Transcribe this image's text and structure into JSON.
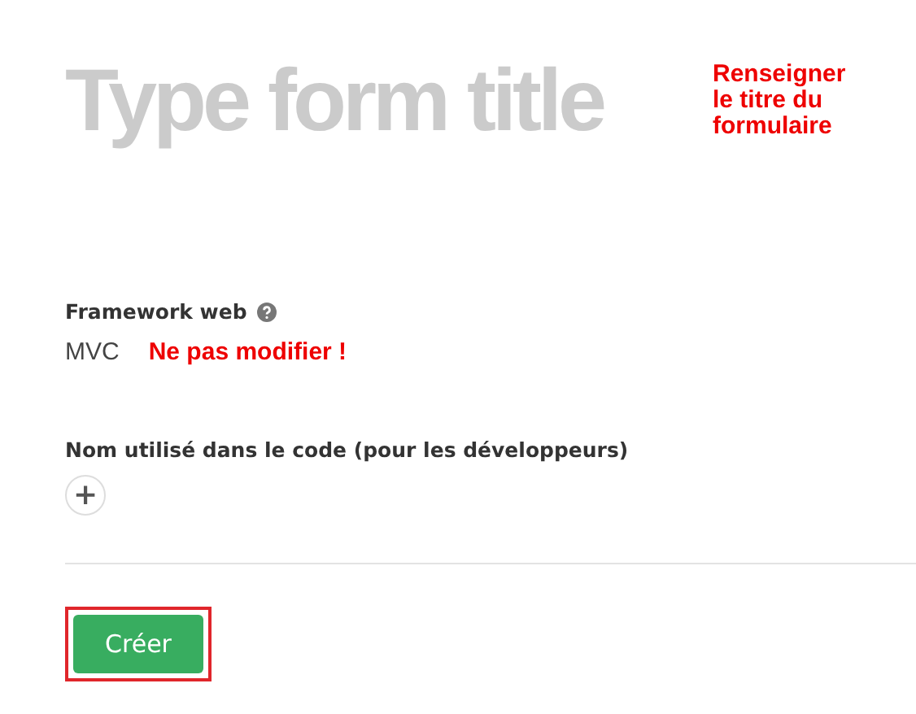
{
  "title_field": {
    "placeholder": "Type form title"
  },
  "title_note": "Renseigner le titre du formulaire",
  "fields": [
    {
      "kind": "value",
      "label": "Framework web",
      "help": true,
      "value": "MVC",
      "note": "Ne pas modifier !"
    },
    {
      "kind": "add",
      "label": "Nom utilisé dans le code (pour les développeurs)",
      "help": false,
      "add_symbol": "+"
    }
  ],
  "submit": {
    "label": "Créer",
    "highlighted": true
  }
}
